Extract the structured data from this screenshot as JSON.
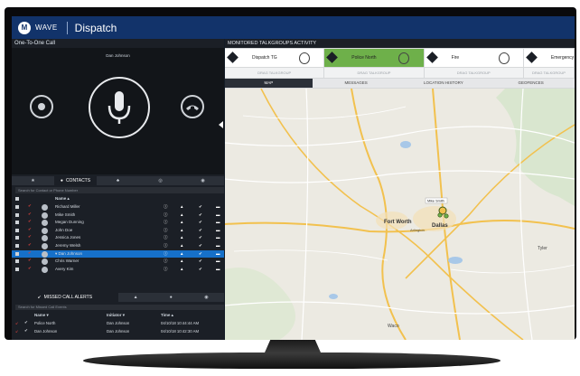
{
  "brand": "WAVE",
  "app_title": "Dispatch",
  "call": {
    "section_title": "One-To-One Call",
    "caller": "Dan Johnson"
  },
  "contacts_tab": "CONTACTS",
  "contacts_search": "Search for Contact or Phone Number",
  "contacts_header": {
    "name": "Name ▴"
  },
  "contacts": [
    {
      "name": "Richard Miller"
    },
    {
      "name": "Mike Smith"
    },
    {
      "name": "Megan Dunning"
    },
    {
      "name": "John Doe"
    },
    {
      "name": "Jessica Jones"
    },
    {
      "name": "Jeremy Welsh"
    },
    {
      "name": "▾ Dan Johnson",
      "selected": true
    },
    {
      "name": "Chris Warner"
    },
    {
      "name": "Avery Kim"
    }
  ],
  "alerts_tab": "MISSED CALL ALERTS",
  "alerts_search": "Search for Missed Call Events",
  "alerts_header": {
    "name": "Name ▾",
    "initiator": "Initiator ▾",
    "time": "Time ▴"
  },
  "alerts": [
    {
      "name": "Police North",
      "initiator": "Dan Johnson",
      "time": "04/10/18 10:44:44 AM"
    },
    {
      "name": "Dan Johnson",
      "initiator": "Dan Johnson",
      "time": "04/10/18 10:42:30 AM"
    }
  ],
  "monitor_title": "MONITORED TALKGROUPS ACTIVITY",
  "talkgroups": [
    {
      "name": "Dispatch TG"
    },
    {
      "name": "Police North",
      "active": true
    },
    {
      "name": "Fire"
    },
    {
      "name": "Emergency"
    }
  ],
  "drag_label": "DRAG TALKGROUP",
  "view_tabs": [
    "MAP",
    "MESSAGES",
    "LOCATION HISTORY",
    "GEOFENCES"
  ],
  "map": {
    "cities": {
      "fort_worth": "Fort Worth",
      "dallas": "Dallas",
      "arlington": "Arlington",
      "waco": "Waco",
      "tyler": "Tyler"
    },
    "pin_label": "Mike Smith"
  },
  "colors": {
    "topbar": "#12336a",
    "selected_row": "#1670c9",
    "active_talkgroup": "#6eb04a",
    "map_land": "#eceae2"
  }
}
